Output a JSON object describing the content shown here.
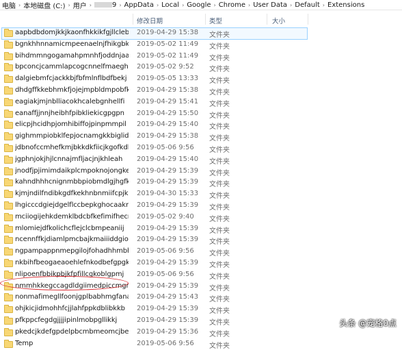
{
  "breadcrumb": [
    "电脑",
    "本地磁盘 (C:)",
    "用户",
    "9",
    "AppData",
    "Local",
    "Google",
    "Chrome",
    "User Data",
    "Default",
    "Extensions"
  ],
  "columns": {
    "date": "修改日期",
    "type": "类型",
    "size": "大小"
  },
  "rows": [
    {
      "name": "aapbdbdomjkkjkaonfhkkikfgjllcleb",
      "date": "2019-04-29 15:38",
      "type": "文件夹"
    },
    {
      "name": "bgnkhhnnamicmpeenaelnjfhikgbkllg",
      "date": "2019-05-02 11:49",
      "type": "文件夹"
    },
    {
      "name": "bihdmmngogamahpmnhfjoddnjaaeo...",
      "date": "2019-05-02 11:49",
      "type": "文件夹"
    },
    {
      "name": "bpconcjcammlapcogcnnelfmaeghhagj",
      "date": "2019-05-02 9:52",
      "type": "文件夹"
    },
    {
      "name": "dalgiebmfcjackkbjfbfmlnflbdfbekj",
      "date": "2019-05-05 13:33",
      "type": "文件夹"
    },
    {
      "name": "dhdgffkkebhmkfjojejmpbldmpobfkfo",
      "date": "2019-04-29 15:38",
      "type": "文件夹"
    },
    {
      "name": "eagiakjmjnblliacokhcalebgnhellfi",
      "date": "2019-04-29 15:41",
      "type": "文件夹"
    },
    {
      "name": "eanaffjjnnjheibhfpibkliekicgpgpn",
      "date": "2019-04-29 15:50",
      "type": "文件夹"
    },
    {
      "name": "elicpjhcidhpjomhibiffojpinpmmpil",
      "date": "2019-04-29 15:40",
      "type": "文件夹"
    },
    {
      "name": "gighmmpiobklfepjocnamgkkbiglidom",
      "date": "2019-04-29 15:38",
      "type": "文件夹"
    },
    {
      "name": "jdbnofccmhefkmjbkkdkfiicjkgofkdh",
      "date": "2019-05-06 9:56",
      "type": "文件夹"
    },
    {
      "name": "jgphnjokjhjlcnnajmfljacjnjkhleah",
      "date": "2019-04-29 15:40",
      "type": "文件夹"
    },
    {
      "name": "jnodfjpjimimdaikplcmpoknojongked",
      "date": "2019-04-29 15:39",
      "type": "文件夹"
    },
    {
      "name": "kahndhhhcnignmbbpiobmdlgjhgfkfil",
      "date": "2019-04-29 15:39",
      "type": "文件夹"
    },
    {
      "name": "kjmjndilfndibkgdfkekhnbnmiifcpjk",
      "date": "2019-04-30 15:33",
      "type": "文件夹"
    },
    {
      "name": "lhgicccdgiejdgelflccbepkghocaakn",
      "date": "2019-04-29 15:39",
      "type": "文件夹"
    },
    {
      "name": "mciiogijehkdemklbdcbfkefimifhecn",
      "date": "2019-05-02 9:40",
      "type": "文件夹"
    },
    {
      "name": "mlomiejdfkolichcflejclcbmpeaniij",
      "date": "2019-04-29 15:39",
      "type": "文件夹"
    },
    {
      "name": "ncennffkjdiamlpmcbajkmaiiiddgioo",
      "date": "2019-04-29 15:39",
      "type": "文件夹"
    },
    {
      "name": "ngpampappnmepgilojfohadhhmbhla...",
      "date": "2019-05-06 9:56",
      "type": "文件夹"
    },
    {
      "name": "nkbihfbeogaeaoehlefnkodbefgpgknn",
      "date": "2019-04-29 15:39",
      "type": "文件夹"
    },
    {
      "name": "nlipoenfbbikpbjkfpfillcgkoblgpmj",
      "date": "2019-05-06 9:56",
      "type": "文件夹"
    },
    {
      "name": "nmmhkkegccagdldgiimedpiccmgmie...",
      "date": "2019-04-29 15:39",
      "type": "文件夹"
    },
    {
      "name": "nonmafimegllfoonjgplbabhmgfanaka",
      "date": "2019-04-29 15:43",
      "type": "文件夹"
    },
    {
      "name": "ohjkicjidmohhfcjjlahfppkdblibkkb",
      "date": "2019-04-29 15:39",
      "type": "文件夹"
    },
    {
      "name": "pfkppcfegdgjjjjipinlmobpgllikkj",
      "date": "2019-04-29 15:39",
      "type": "文件夹"
    },
    {
      "name": "pkedcjkdefgpdelpbcmbmeomcjbee...",
      "date": "2019-04-29 15:36",
      "type": "文件夹"
    },
    {
      "name": "Temp",
      "date": "2019-05-06 9:56",
      "type": "文件夹"
    }
  ],
  "watermark": "头条 @宠格0点",
  "colors": {
    "folder": "#f8d775",
    "header_text": "#4c607a",
    "highlight": "#d9262c",
    "selection": "#99d1ff"
  }
}
